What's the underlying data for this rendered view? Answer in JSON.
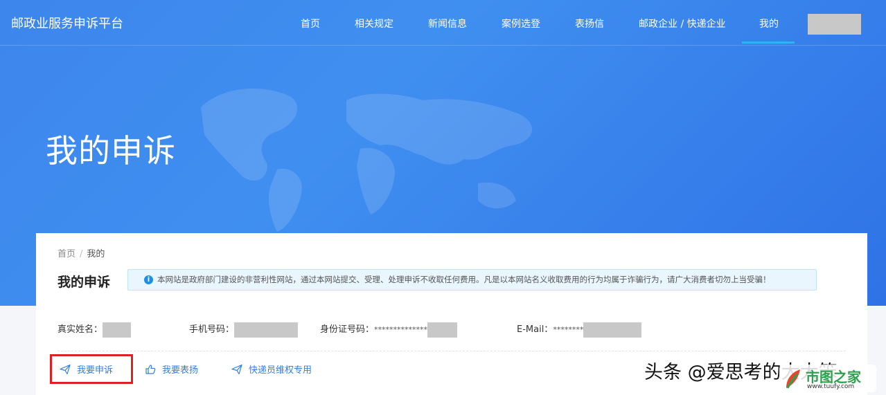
{
  "header": {
    "brand": "邮政业服务申诉平台",
    "nav": [
      {
        "label": "首页"
      },
      {
        "label": "相关规定"
      },
      {
        "label": "新闻信息"
      },
      {
        "label": "案例选登"
      },
      {
        "label": "表扬信"
      },
      {
        "label": "邮政企业 / 快递企业"
      },
      {
        "label": "我的",
        "active": true
      }
    ]
  },
  "hero": {
    "title": "我的申诉"
  },
  "breadcrumb": {
    "home": "首页",
    "separator": "/",
    "current": "我的"
  },
  "card": {
    "title": "我的申诉",
    "notice": "本网站是政府部门建设的非营利性网站，通过本网站提交、受理、处理申诉不收取任何费用。凡是以本网站名义收取费用的行为均属于诈骗行为，请广大消费者切勿上当受骗！"
  },
  "profile": {
    "name_label": "真实姓名：",
    "phone_label": "手机号码：",
    "id_label": "身份证号码：",
    "id_value": "**************",
    "email_label": "E-Mail：",
    "email_value": "********"
  },
  "actions": [
    {
      "label": "我要申诉",
      "icon": "paper-plane-icon"
    },
    {
      "label": "我要表扬",
      "icon": "thumbs-up-icon"
    },
    {
      "label": "快递员维权专用",
      "icon": "paper-plane-icon"
    }
  ],
  "watermark": {
    "text": "头条 @爱思考的大大笨",
    "logo_title": "市图之家",
    "logo_url": "www.tuufy.com"
  },
  "colors": {
    "hero_blue": "#3d86ec",
    "accent_link": "#2f7fe0",
    "nav_underline": "#2db4f3",
    "highlight_red": "#e02020",
    "notice_bg": "#eaf6fe"
  }
}
